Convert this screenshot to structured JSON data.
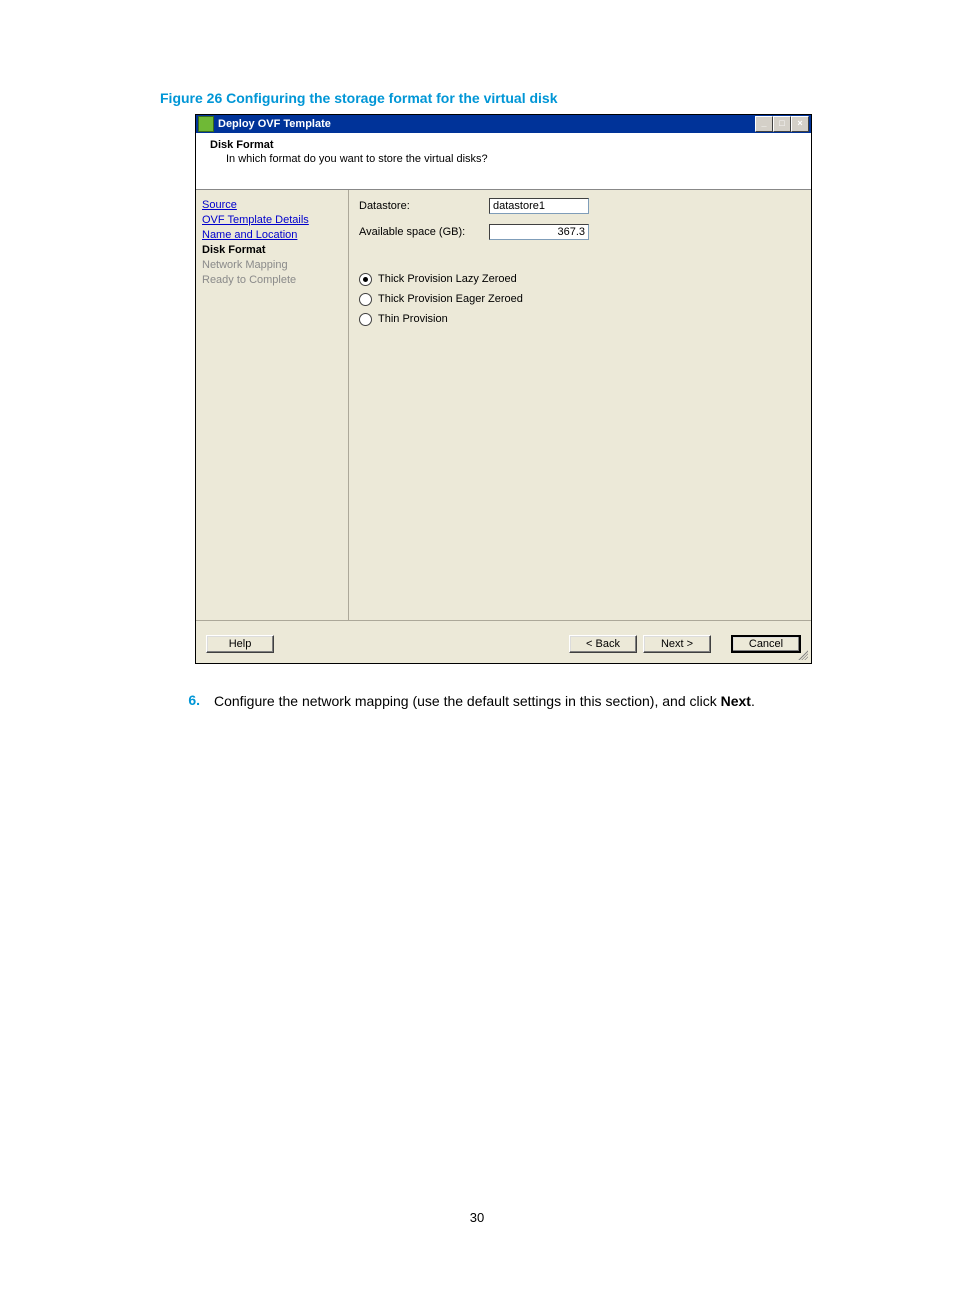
{
  "figure_caption": "Figure 26 Configuring the storage format for the virtual disk",
  "dialog": {
    "title": "Deploy OVF Template",
    "header": {
      "title": "Disk Format",
      "subtitle": "In which format do you want to store the virtual disks?"
    },
    "sidebar": [
      {
        "label": "Source",
        "state": "link"
      },
      {
        "label": "OVF Template Details",
        "state": "link"
      },
      {
        "label": "Name and Location",
        "state": "link"
      },
      {
        "label": "Disk Format",
        "state": "current"
      },
      {
        "label": "Network Mapping",
        "state": "disabled"
      },
      {
        "label": "Ready to Complete",
        "state": "disabled"
      }
    ],
    "fields": {
      "datastore_label": "Datastore:",
      "datastore_value": "datastore1",
      "avail_label": "Available space (GB):",
      "avail_value": "367.3"
    },
    "radios": [
      {
        "label": "Thick Provision Lazy Zeroed",
        "selected": true
      },
      {
        "label": "Thick Provision Eager Zeroed",
        "selected": false
      },
      {
        "label": "Thin Provision",
        "selected": false
      }
    ],
    "buttons": {
      "help": "Help",
      "back": "< Back",
      "next": "Next >",
      "cancel": "Cancel"
    }
  },
  "step": {
    "num": "6.",
    "text_before": "Configure the network mapping (use the default settings in this section), and click ",
    "text_bold": "Next",
    "text_after": "."
  },
  "page_number": "30"
}
